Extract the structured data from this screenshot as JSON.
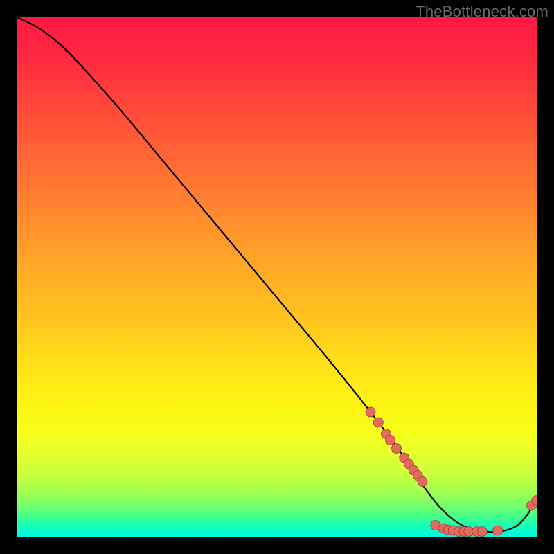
{
  "watermark": "TheBottleneck.com",
  "chart_data": {
    "type": "line",
    "title": "",
    "xlabel": "",
    "ylabel": "",
    "xlim": [
      0,
      100
    ],
    "ylim": [
      0,
      100
    ],
    "grid": false,
    "legend": false,
    "series": [
      {
        "name": "curve",
        "x": [
          0,
          4,
          8,
          12,
          20,
          30,
          40,
          50,
          60,
          68,
          74,
          78,
          82,
          86,
          90,
          93,
          96,
          98,
          100
        ],
        "y": [
          100,
          98,
          95,
          91,
          82,
          70,
          58,
          46,
          34,
          24,
          16,
          10,
          5,
          2,
          1,
          1,
          2,
          4,
          7
        ]
      }
    ],
    "markers": [
      {
        "x": 68.0,
        "y": 24.0
      },
      {
        "x": 69.5,
        "y": 22.0
      },
      {
        "x": 71.0,
        "y": 19.8
      },
      {
        "x": 71.8,
        "y": 18.6
      },
      {
        "x": 73.0,
        "y": 17.0
      },
      {
        "x": 74.5,
        "y": 15.2
      },
      {
        "x": 75.4,
        "y": 14.0
      },
      {
        "x": 76.3,
        "y": 12.8
      },
      {
        "x": 77.1,
        "y": 11.8
      },
      {
        "x": 78.0,
        "y": 10.6
      },
      {
        "x": 80.5,
        "y": 2.2
      },
      {
        "x": 82.0,
        "y": 1.6
      },
      {
        "x": 83.0,
        "y": 1.3
      },
      {
        "x": 83.9,
        "y": 1.2
      },
      {
        "x": 85.0,
        "y": 1.0
      },
      {
        "x": 86.0,
        "y": 1.0
      },
      {
        "x": 86.9,
        "y": 1.0
      },
      {
        "x": 88.5,
        "y": 1.0
      },
      {
        "x": 89.5,
        "y": 1.0
      },
      {
        "x": 92.5,
        "y": 1.2
      },
      {
        "x": 99.0,
        "y": 6.0
      },
      {
        "x": 100.0,
        "y": 7.0
      }
    ],
    "colors": {
      "curve": "#000000",
      "marker_fill": "#e46a5e",
      "marker_stroke": "#9c3a2f"
    }
  }
}
